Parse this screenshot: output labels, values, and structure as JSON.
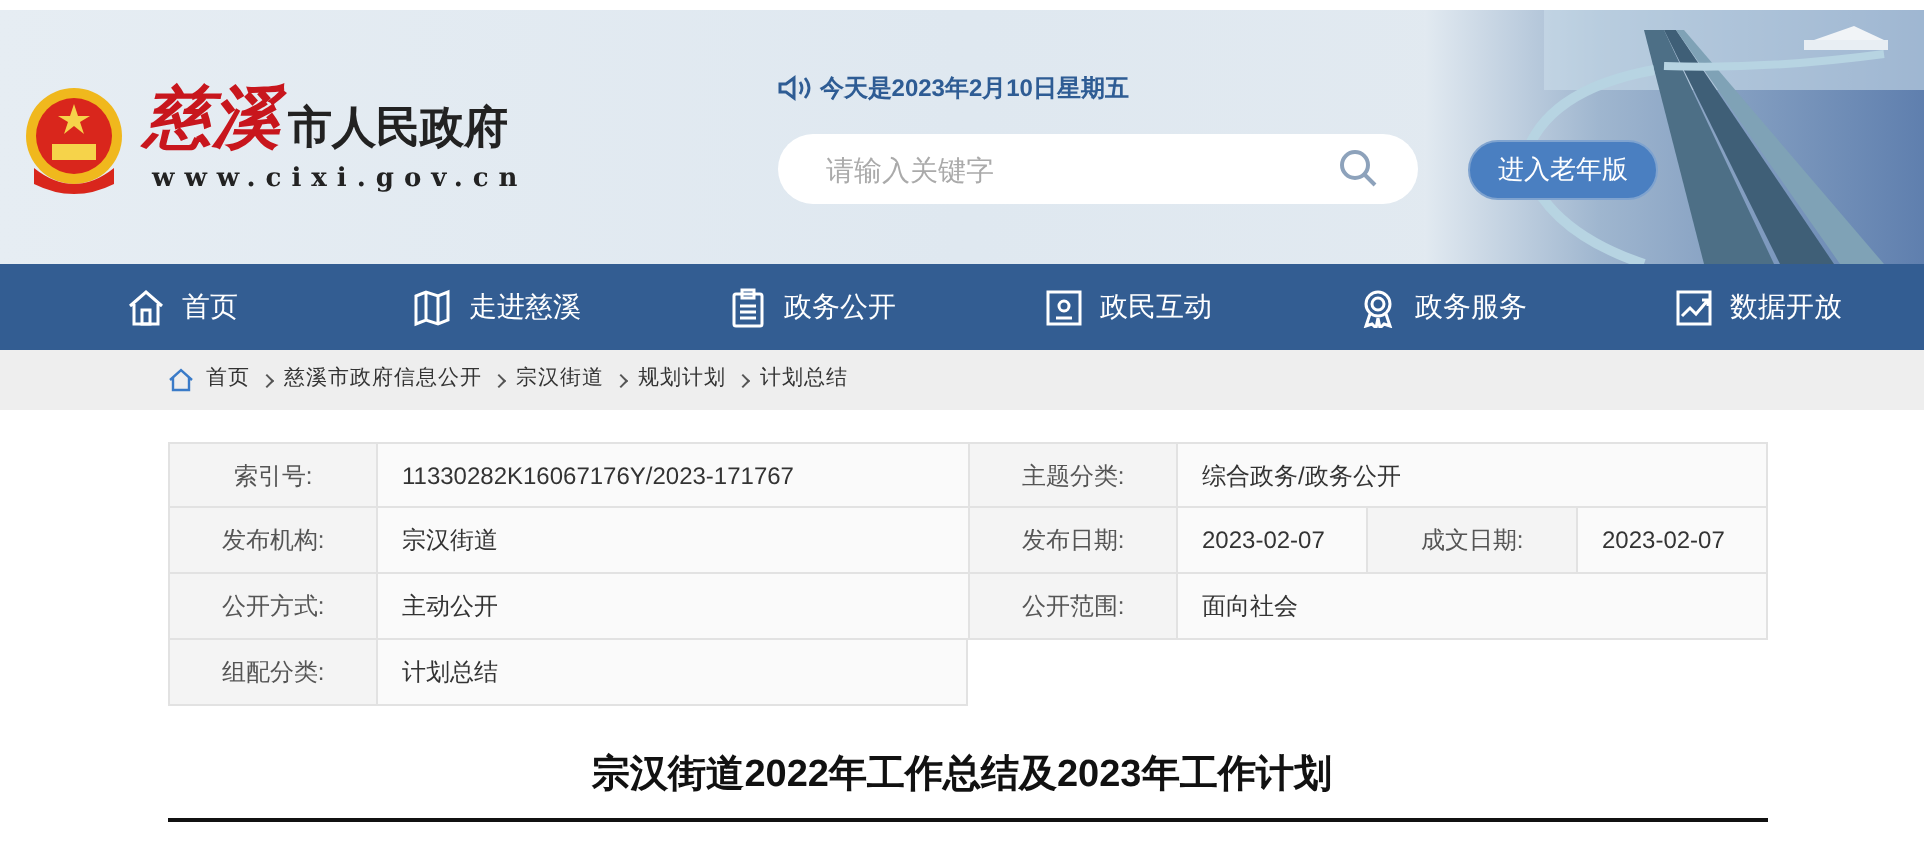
{
  "header": {
    "logo_script": "慈溪",
    "logo_title": "市人民政府",
    "logo_url": "www.cixi.gov.cn",
    "date": "今天是2023年2月10日星期五",
    "search": {
      "placeholder": "请输入关键字"
    },
    "elder_button": "进入老年版"
  },
  "nav": [
    {
      "label": "首页"
    },
    {
      "label": "走进慈溪"
    },
    {
      "label": "政务公开"
    },
    {
      "label": "政民互动"
    },
    {
      "label": "政务服务"
    },
    {
      "label": "数据开放"
    }
  ],
  "breadcrumb": [
    "首页",
    "慈溪市政府信息公开",
    "宗汉街道",
    "规划计划",
    "计划总结"
  ],
  "info_table": [
    {
      "pairs": [
        {
          "label": "索引号:",
          "value": "11330282K16067176Y/2023-171767"
        },
        {
          "label": "主题分类:",
          "value": "综合政务/政务公开"
        }
      ]
    },
    {
      "pairs": [
        {
          "label": "发布机构:",
          "value": "宗汉街道"
        },
        {
          "label": "发布日期:",
          "value": "2023-02-07"
        },
        {
          "label": "成文日期:",
          "value": "2023-02-07"
        }
      ]
    },
    {
      "pairs": [
        {
          "label": "公开方式:",
          "value": "主动公开"
        },
        {
          "label": "公开范围:",
          "value": "面向社会"
        }
      ]
    },
    {
      "pairs": [
        {
          "label": "组配分类:",
          "value": "计划总结"
        }
      ]
    }
  ],
  "article_title": "宗汉街道2022年工作总结及2023年工作计划"
}
